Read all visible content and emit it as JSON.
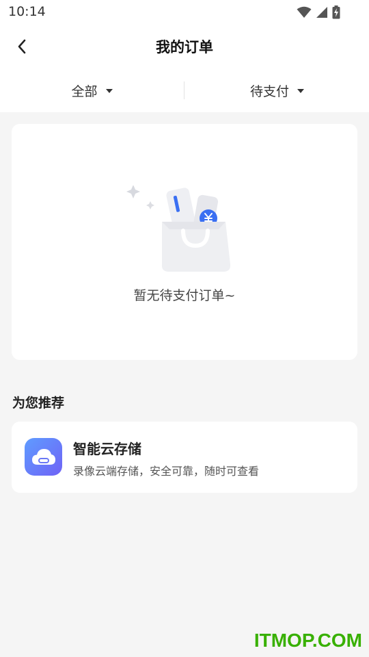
{
  "status_bar": {
    "time": "10:14"
  },
  "header": {
    "title": "我的订单"
  },
  "filters": [
    {
      "label": "全部"
    },
    {
      "label": "待支付"
    }
  ],
  "empty_state": {
    "message": "暂无待支付订单~"
  },
  "recommend": {
    "section_title": "为您推荐",
    "items": [
      {
        "title": "智能云存储",
        "description": "录像云端存储，安全可靠，随时可查看",
        "icon": "cloud-storage-icon"
      }
    ]
  },
  "colors": {
    "page_bg": "#f5f5f5",
    "card_bg": "#ffffff",
    "accent_blue": "#3a6ff2",
    "watermark_green": "#38b000"
  },
  "watermark": "ITMOP.COM"
}
